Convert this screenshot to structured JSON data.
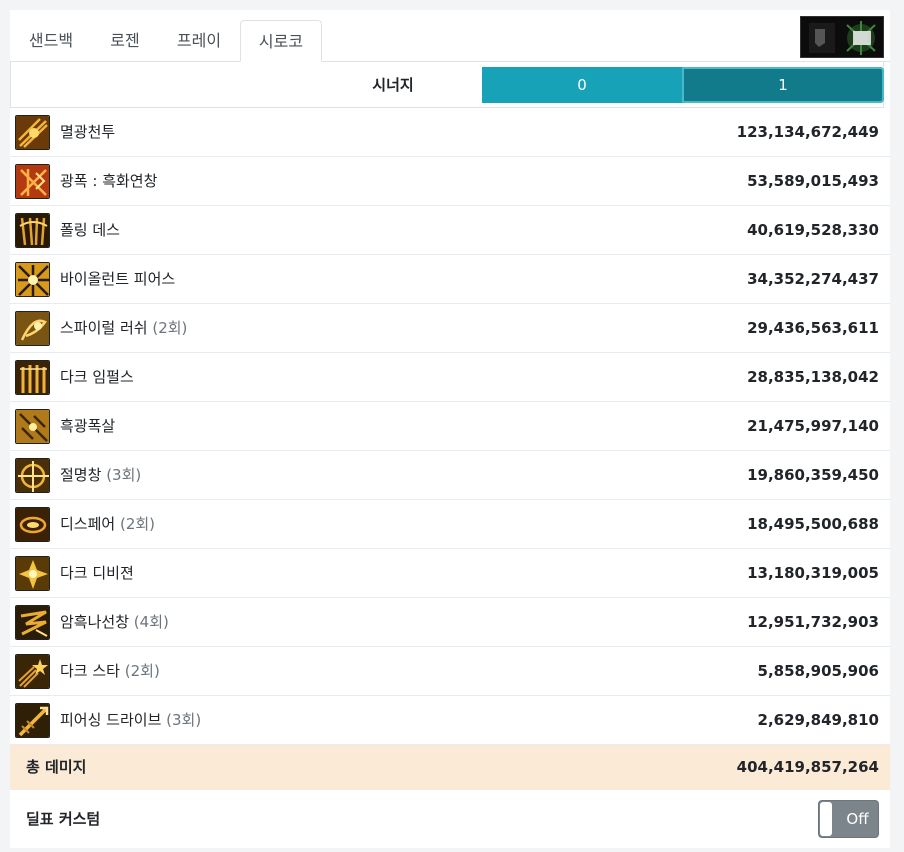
{
  "tabs": [
    {
      "label": "샌드백"
    },
    {
      "label": "로젠"
    },
    {
      "label": "프레이"
    },
    {
      "label": "시로코"
    }
  ],
  "active_tab": "시로코",
  "synergy": {
    "label": "시너지",
    "options": [
      "0",
      "1"
    ],
    "selected": "1"
  },
  "skills": [
    {
      "name": "멸광천투",
      "count": "",
      "damage": "123,134,672,449",
      "icon": "skill-icon-1"
    },
    {
      "name": "광폭 : 흑화연창",
      "count": "",
      "damage": "53,589,015,493",
      "icon": "skill-icon-2"
    },
    {
      "name": "폴링 데스",
      "count": "",
      "damage": "40,619,528,330",
      "icon": "skill-icon-3"
    },
    {
      "name": "바이올런트 피어스",
      "count": "",
      "damage": "34,352,274,437",
      "icon": "skill-icon-4"
    },
    {
      "name": "스파이럴 러쉬",
      "count": "(2회)",
      "damage": "29,436,563,611",
      "icon": "skill-icon-5"
    },
    {
      "name": "다크 임펄스",
      "count": "",
      "damage": "28,835,138,042",
      "icon": "skill-icon-6"
    },
    {
      "name": "흑광폭살",
      "count": "",
      "damage": "21,475,997,140",
      "icon": "skill-icon-7"
    },
    {
      "name": "절명창",
      "count": "(3회)",
      "damage": "19,860,359,450",
      "icon": "skill-icon-8"
    },
    {
      "name": "디스페어",
      "count": "(2회)",
      "damage": "18,495,500,688",
      "icon": "skill-icon-9"
    },
    {
      "name": "다크 디비젼",
      "count": "",
      "damage": "13,180,319,005",
      "icon": "skill-icon-10"
    },
    {
      "name": "암흑나선창",
      "count": "(4회)",
      "damage": "12,951,732,903",
      "icon": "skill-icon-11"
    },
    {
      "name": "다크 스타",
      "count": "(2회)",
      "damage": "5,858,905,906",
      "icon": "skill-icon-12"
    },
    {
      "name": "피어싱 드라이브",
      "count": "(3회)",
      "damage": "2,629,849,810",
      "icon": "skill-icon-13"
    }
  ],
  "total": {
    "label": "총 데미지",
    "value": "404,419,857,264"
  },
  "custom": {
    "label": "딜표 커스텀",
    "toggle": "Off"
  },
  "colors": {
    "synergy_inactive": "#17a2b8",
    "synergy_active": "#117a8b",
    "total_bg": "#fbead6",
    "toggle_off": "#7d858c"
  }
}
